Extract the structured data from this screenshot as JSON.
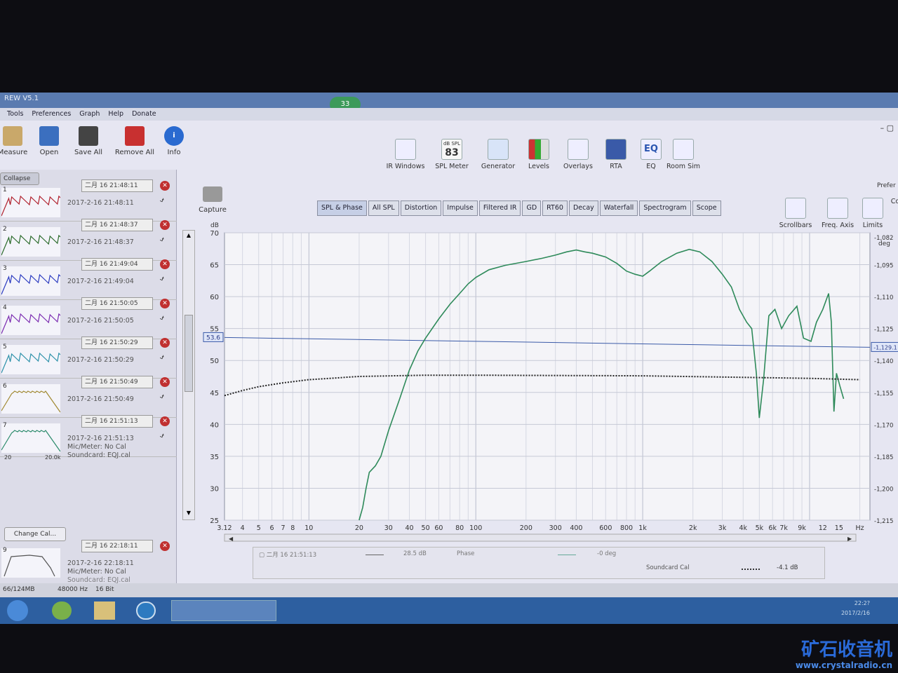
{
  "window": {
    "title": "REW V5.1",
    "badge": "33",
    "win_controls": "– ▢"
  },
  "menu": [
    "Tools",
    "Preferences",
    "Graph",
    "Help",
    "Donate"
  ],
  "toolbar_left": [
    {
      "label": "Measure",
      "icon": "microphone-icon"
    },
    {
      "label": "Open",
      "icon": "folder-icon"
    },
    {
      "label": "Save All",
      "icon": "save-icon"
    },
    {
      "label": "Remove All",
      "icon": "remove-icon"
    },
    {
      "label": "Info",
      "icon": "info-icon"
    }
  ],
  "toolbar_right": [
    {
      "label": "IR Windows",
      "icon": "ir-windows-icon"
    },
    {
      "label": "SPL Meter",
      "icon": "spl-meter-icon",
      "top": "dB SPL",
      "value": "83"
    },
    {
      "label": "Generator",
      "icon": "generator-icon"
    },
    {
      "label": "Levels",
      "icon": "levels-icon"
    },
    {
      "label": "Overlays",
      "icon": "overlays-icon"
    },
    {
      "label": "RTA",
      "icon": "rta-icon"
    },
    {
      "label": "EQ",
      "icon": "eq-icon",
      "text": "EQ"
    },
    {
      "label": "Room Sim",
      "icon": "room-sim-icon"
    }
  ],
  "capture": {
    "label": "Capture"
  },
  "collapse": "Collapse",
  "tabs": [
    "SPL & Phase",
    "All SPL",
    "Distortion",
    "Impulse",
    "Filtered IR",
    "GD",
    "RT60",
    "Decay",
    "Waterfall",
    "Spectrogram",
    "Scope"
  ],
  "active_tab": "SPL & Phase",
  "right_tools": [
    {
      "label": "Scrollbars",
      "icon": "scrollbars-icon"
    },
    {
      "label": "Freq. Axis",
      "icon": "freq-axis-icon"
    },
    {
      "label": "Limits",
      "icon": "limits-icon"
    },
    {
      "label": "Co",
      "icon": "controls-icon"
    }
  ],
  "prefs": "Prefer",
  "measurements": [
    {
      "num": "1",
      "tab": "二月 16 21:48:11",
      "date": "2017-2-16 21:48:11",
      "color": "#b0202c"
    },
    {
      "num": "2",
      "tab": "二月 16 21:48:37",
      "date": "2017-2-16 21:48:37",
      "color": "#2a6a2a"
    },
    {
      "num": "3",
      "tab": "二月 16 21:49:04",
      "date": "2017-2-16 21:49:04",
      "color": "#2a3ac0"
    },
    {
      "num": "4",
      "tab": "二月 16 21:50:05",
      "date": "2017-2-16 21:50:05",
      "color": "#7a2ab0"
    },
    {
      "num": "5",
      "tab": "二月 16 21:50:29",
      "date": "2017-2-16 21:50:29",
      "color": "#2a90a8"
    },
    {
      "num": "6",
      "tab": "二月 16 21:50:49",
      "date": "2017-2-16 21:50:49",
      "color": "#a08830"
    },
    {
      "num": "7",
      "tab": "二月 16 21:51:13",
      "date": "2017-2-16 21:51:13",
      "color": "#2a8a6a",
      "mic": "Mic/Meter: No Cal",
      "soundcard": "Soundcard: EQJ.cal",
      "xlo": "20",
      "xhi": "20.0k"
    }
  ],
  "measurement_9": {
    "num": "9",
    "tab": "二月 16 22:18:11",
    "date": "2017-2-16 22:18:11",
    "mic": "Mic/Meter: No Cal",
    "soundcard": "Soundcard: EQJ.cal"
  },
  "change_cal": "Change Cal...",
  "chart_data": {
    "type": "line",
    "ylabel": "dB",
    "y2label": "deg",
    "ylim": [
      25,
      70
    ],
    "yticks": [
      "70",
      "65",
      "60",
      "55",
      "50",
      "45",
      "40",
      "35",
      "30",
      "25"
    ],
    "y2ticks": [
      "-1,082",
      "-1,095",
      "-1,110",
      "-1,125",
      "-1,140",
      "-1,155",
      "-1,170",
      "-1,185",
      "-1,200",
      "-1,215"
    ],
    "y2lim": [
      -1215,
      -1080
    ],
    "xscale": "log",
    "xlim": [
      3.12,
      23000
    ],
    "xticks": [
      {
        "v": 3.12,
        "label": "3.12"
      },
      {
        "v": 4,
        "label": "4"
      },
      {
        "v": 5,
        "label": "5"
      },
      {
        "v": 6,
        "label": "6"
      },
      {
        "v": 7,
        "label": "7"
      },
      {
        "v": 8,
        "label": "8"
      },
      {
        "v": 10,
        "label": "10"
      },
      {
        "v": 20,
        "label": "20"
      },
      {
        "v": 30,
        "label": "30"
      },
      {
        "v": 40,
        "label": "40"
      },
      {
        "v": 50,
        "label": "50"
      },
      {
        "v": 60,
        "label": "60"
      },
      {
        "v": 80,
        "label": "80"
      },
      {
        "v": 100,
        "label": "100"
      },
      {
        "v": 200,
        "label": "200"
      },
      {
        "v": 300,
        "label": "300"
      },
      {
        "v": 400,
        "label": "400"
      },
      {
        "v": 600,
        "label": "600"
      },
      {
        "v": 800,
        "label": "800"
      },
      {
        "v": 1000,
        "label": "1k"
      },
      {
        "v": 2000,
        "label": "2k"
      },
      {
        "v": 3000,
        "label": "3k"
      },
      {
        "v": 4000,
        "label": "4k"
      },
      {
        "v": 5000,
        "label": "5k"
      },
      {
        "v": 6000,
        "label": "6k"
      },
      {
        "v": 7000,
        "label": "7k"
      },
      {
        "v": 9000,
        "label": "9k"
      },
      {
        "v": 12000,
        "label": "12"
      },
      {
        "v": 15000,
        "label": "15"
      },
      {
        "v": 20000,
        "label": "Hz"
      }
    ],
    "cursor_db": "53.6",
    "cursor_deg": "-1,129.1",
    "grid": true,
    "series": [
      {
        "color": "#2e8a5a",
        "style": "solid",
        "points": [
          [
            20,
            25
          ],
          [
            21,
            27
          ],
          [
            22,
            30
          ],
          [
            23,
            32.5
          ],
          [
            25,
            33.5
          ],
          [
            27,
            35
          ],
          [
            30,
            39
          ],
          [
            35,
            44
          ],
          [
            40,
            48.5
          ],
          [
            45,
            51.5
          ],
          [
            50,
            53.5
          ],
          [
            60,
            56.5
          ],
          [
            70,
            58.8
          ],
          [
            80,
            60.5
          ],
          [
            90,
            62
          ],
          [
            100,
            63
          ],
          [
            120,
            64.2
          ],
          [
            150,
            64.9
          ],
          [
            200,
            65.5
          ],
          [
            250,
            66
          ],
          [
            300,
            66.5
          ],
          [
            350,
            67
          ],
          [
            400,
            67.3
          ],
          [
            450,
            67
          ],
          [
            500,
            66.8
          ],
          [
            600,
            66.2
          ],
          [
            700,
            65.2
          ],
          [
            800,
            64
          ],
          [
            900,
            63.5
          ],
          [
            1000,
            63.2
          ],
          [
            1100,
            64
          ],
          [
            1300,
            65.5
          ],
          [
            1600,
            66.8
          ],
          [
            1900,
            67.4
          ],
          [
            2200,
            67
          ],
          [
            2600,
            65.5
          ],
          [
            3000,
            63.5
          ],
          [
            3400,
            61.5
          ],
          [
            3800,
            58
          ],
          [
            4200,
            56
          ],
          [
            4500,
            55
          ],
          [
            4800,
            48
          ],
          [
            5000,
            41
          ],
          [
            5300,
            47
          ],
          [
            5700,
            57
          ],
          [
            6200,
            58
          ],
          [
            6800,
            55
          ],
          [
            7500,
            57
          ],
          [
            8400,
            58.5
          ],
          [
            9200,
            53.5
          ],
          [
            10200,
            53
          ],
          [
            11000,
            56
          ],
          [
            12000,
            58
          ],
          [
            13000,
            60.5
          ],
          [
            13500,
            56
          ],
          [
            14000,
            42
          ],
          [
            14500,
            48
          ],
          [
            15200,
            46
          ],
          [
            16000,
            44
          ]
        ]
      },
      {
        "color": "#222222",
        "style": "dotted",
        "points": [
          [
            3.12,
            44.5
          ],
          [
            4,
            45.3
          ],
          [
            5,
            45.9
          ],
          [
            7,
            46.5
          ],
          [
            10,
            47
          ],
          [
            20,
            47.5
          ],
          [
            50,
            47.7
          ],
          [
            100,
            47.7
          ],
          [
            1000,
            47.6
          ],
          [
            10000,
            47.2
          ],
          [
            20000,
            47
          ]
        ]
      }
    ]
  },
  "legend": {
    "series1": "▢ 二月 16 21:51:13",
    "series1_val": "28.5 dB",
    "phase": "Phase",
    "phase_val": "-0 deg",
    "cal": "Soundcard Cal",
    "cal_val": "-4.1 dB"
  },
  "status": {
    "mem": "66/124MB",
    "rate": "48000 Hz",
    "bits": "16 Bit"
  },
  "clock": {
    "time": "22:2?",
    "date": "2017/2/16"
  },
  "watermark": {
    "cn": "矿石收音机",
    "url": "www.crystalradio.cn"
  }
}
